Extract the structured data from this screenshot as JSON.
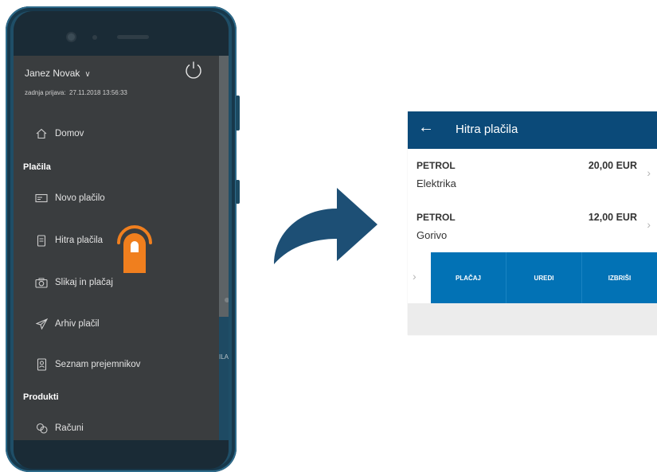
{
  "drawer": {
    "user_name": "Janez Novak",
    "last_login_label": "zadnja prijava:",
    "last_login_value": "27.11.2018 13:56:33",
    "items": {
      "home": "Domov",
      "new_payment": "Novo plačilo",
      "quick_payments": "Hitra plačila",
      "snap_pay": "Slikaj in plačaj",
      "archive": "Arhiv plačil",
      "recipients": "Seznam prejemnikov",
      "accounts": "Računi"
    },
    "sections": {
      "payments": "Plačila",
      "products": "Produkti"
    },
    "background_partial_text": "ILA"
  },
  "detail": {
    "title": "Hitra plačila",
    "rows": [
      {
        "payee": "PETROL",
        "purpose": "Elektrika",
        "amount": "20,00 EUR"
      },
      {
        "payee": "PETROL",
        "purpose": "Gorivo",
        "amount": "12,00 EUR"
      }
    ],
    "actions": {
      "pay": "PLAČAJ",
      "edit": "UREDI",
      "delete": "IZBRIŠI"
    }
  },
  "colors": {
    "phone_body": "#1f4e67",
    "drawer_bg": "#3a3d3f",
    "header_blue": "#0b4a79",
    "action_blue": "#0272b5",
    "tap_orange": "#f07f1e",
    "arrow_blue": "#1d4f75"
  },
  "icons": [
    "power-icon",
    "home-icon",
    "new-payment-icon",
    "quick-payment-icon",
    "camera-icon",
    "send-icon",
    "contacts-icon",
    "accounts-icon",
    "tap-gesture-icon",
    "back-arrow-icon",
    "chevron-right-icon"
  ]
}
